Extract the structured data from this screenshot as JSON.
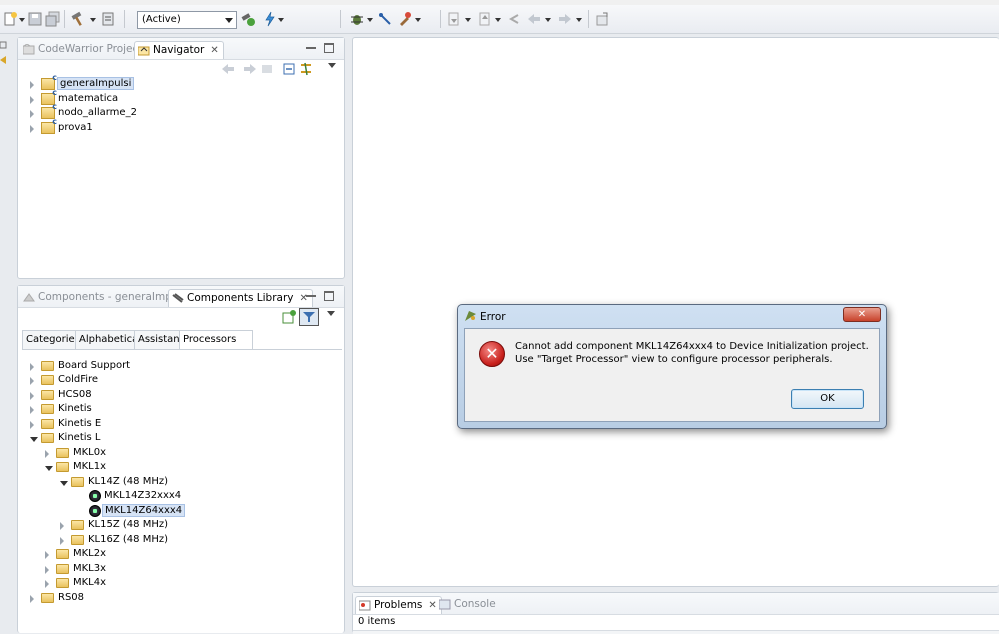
{
  "toolbar": {
    "config_combo": "(Active)"
  },
  "navigator_panel": {
    "tabs": [
      "CodeWarrior Projects",
      "Navigator"
    ],
    "projects": [
      "generaImpulsi",
      "matematica",
      "nodo_allarme_2",
      "prova1"
    ]
  },
  "components_panel": {
    "tabs": [
      "Components - generaImpulsi",
      "Components Library"
    ],
    "subtabs": [
      "Categories",
      "Alphabetical",
      "Assistant",
      "Processors"
    ],
    "tree": {
      "board_support": "Board Support",
      "coldfire": "ColdFire",
      "hcs08": "HCS08",
      "kinetis": "Kinetis",
      "kinetis_e": "Kinetis E",
      "kinetis_l": "Kinetis L",
      "mkl0x": "MKL0x",
      "mkl1x": "MKL1x",
      "kl14z": "KL14Z (48 MHz)",
      "mkl14z32": "MKL14Z32xxx4",
      "mkl14z64": "MKL14Z64xxx4",
      "kl15z": "KL15Z (48 MHz)",
      "kl16z": "KL16Z (48 MHz)",
      "mkl2x": "MKL2x",
      "mkl3x": "MKL3x",
      "mkl4x": "MKL4x",
      "rs08": "RS08"
    }
  },
  "bottom_panel": {
    "tabs": [
      "Problems",
      "Console"
    ],
    "status": "0 items"
  },
  "dialog": {
    "title": "Error",
    "message": "Cannot add component MKL14Z64xxx4 to Device Initialization project. Use \"Target Processor\" view to configure processor peripherals.",
    "ok_label": "OK"
  }
}
